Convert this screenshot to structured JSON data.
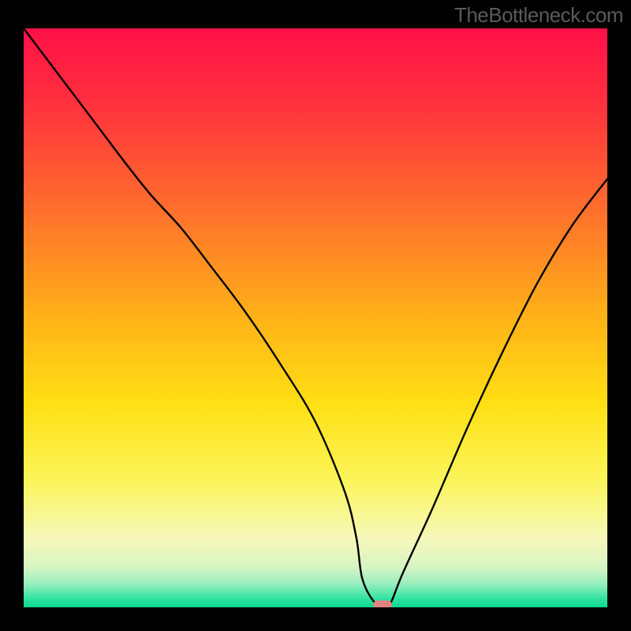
{
  "watermark": "TheBottleneck.com",
  "chart_data": {
    "type": "line",
    "title": "",
    "xlabel": "",
    "ylabel": "",
    "xlim": [
      0,
      100
    ],
    "ylim": [
      0,
      100
    ],
    "grid": false,
    "legend": false,
    "background_gradient": {
      "stops": [
        {
          "offset": 0,
          "color": "#ff1048"
        },
        {
          "offset": 12,
          "color": "#ff2e3e"
        },
        {
          "offset": 30,
          "color": "#ff6a2e"
        },
        {
          "offset": 50,
          "color": "#ffb218"
        },
        {
          "offset": 65,
          "color": "#ffe014"
        },
        {
          "offset": 78,
          "color": "#fbf55a"
        },
        {
          "offset": 88,
          "color": "#f6f8b9"
        },
        {
          "offset": 93,
          "color": "#d8f5c4"
        },
        {
          "offset": 96,
          "color": "#97eebd"
        },
        {
          "offset": 98.5,
          "color": "#2fe3a0"
        },
        {
          "offset": 100,
          "color": "#0cd890"
        }
      ]
    },
    "series": [
      {
        "name": "bottleneck-curve",
        "x": [
          0,
          6,
          12,
          18,
          22,
          27,
          32,
          38,
          44,
          50,
          55,
          57,
          58,
          60,
          62,
          63,
          65,
          70,
          76,
          82,
          88,
          94,
          100
        ],
        "y": [
          100,
          92,
          84,
          76,
          71,
          65.5,
          59,
          51,
          42,
          32,
          20,
          12,
          5,
          1,
          0,
          1,
          6,
          17,
          31,
          44,
          56,
          66,
          74
        ]
      }
    ],
    "marker": {
      "name": "optimal-point",
      "x": 61.5,
      "y": 0.5,
      "color": "#e2817f",
      "width_pct": 3.2,
      "height_pct": 1.4
    }
  }
}
